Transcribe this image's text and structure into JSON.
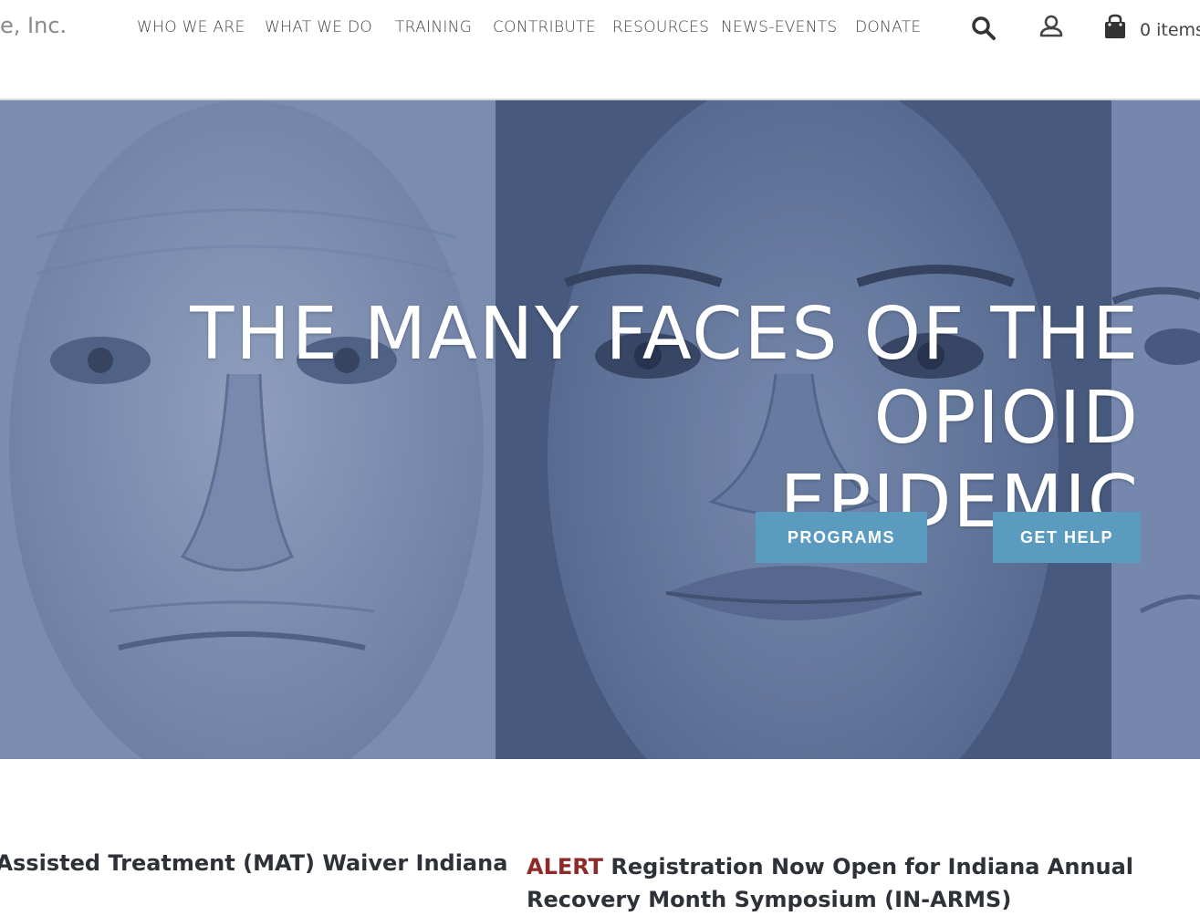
{
  "header": {
    "logo_text": "e, Inc.",
    "nav": [
      {
        "label": "WHO WE ARE"
      },
      {
        "label": "WHAT WE DO"
      },
      {
        "label": "TRAINING"
      },
      {
        "label": "CONTRIBUTE"
      },
      {
        "label": "RESOURCES"
      },
      {
        "label": "NEWS-EVENTS"
      },
      {
        "label": "DONATE"
      }
    ],
    "icons": {
      "search": "search-icon",
      "account": "user-icon",
      "cart": "shopping-bag-icon"
    },
    "cart_label": "0 items"
  },
  "hero": {
    "title_line1": "THE MANY FACES OF THE OPIOID",
    "title_line2": "EPIDEMIC",
    "buttons": {
      "programs": "PROGRAMS",
      "get_help": "GET HELP"
    },
    "overlay_color": "#5d7196",
    "button_color": "#5b9bbf"
  },
  "news": {
    "left_headline": "n Assisted Treatment (MAT) Waiver Indiana",
    "right_alert": "ALERT",
    "right_headline": "Registration Now Open for Indiana Annual Recovery Month Symposium (IN-ARMS)"
  },
  "colors": {
    "alert": "#8e2a2a",
    "text": "#2e3238",
    "nav": "#444444"
  }
}
